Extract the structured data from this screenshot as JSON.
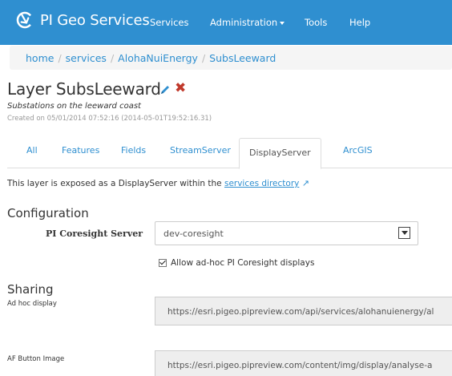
{
  "navbar": {
    "brand": "PI Geo Services",
    "items": [
      {
        "label": "Services"
      },
      {
        "label": "Administration"
      },
      {
        "label": "Tools"
      },
      {
        "label": "Help"
      }
    ]
  },
  "breadcrumb": [
    "home",
    "services",
    "AlohaNuiEnergy",
    "SubsLeeward"
  ],
  "layer": {
    "title": "Layer SubsLeeward",
    "subtitle": "Substations on the leeward coast",
    "created": "Created on 05/01/2014 07:52:16 (2014-05-01T19:52:16.31)"
  },
  "tabs": [
    {
      "label": "All"
    },
    {
      "label": "Features"
    },
    {
      "label": "Fields"
    },
    {
      "label": "StreamServer"
    },
    {
      "label": "DisplayServer",
      "active": true
    },
    {
      "label": "ArcGIS"
    }
  ],
  "exposed": {
    "text": "This layer is exposed as a DisplayServer within the ",
    "link": "services directory"
  },
  "configuration": {
    "heading": "Configuration",
    "server_label": "PI Coresight Server",
    "server_value": "dev-coresight",
    "allow_adhoc_label": "Allow ad-hoc PI Coresight displays",
    "allow_adhoc_checked": true
  },
  "sharing": {
    "heading": "Sharing",
    "adhoc_label": "Ad hoc display",
    "adhoc_url": "https://esri.pigeo.pipreview.com/api/services/alohanuienergy/al",
    "af_label": "AF Button Image",
    "af_url": "https://esri.pigeo.pipreview.com/content/img/display/analyse-a"
  },
  "icons": {
    "logo": "pi-logo-icon",
    "edit": "pencil-icon",
    "delete": "x-icon",
    "external": "external-link-icon",
    "dropdown": "chevron-down-icon"
  },
  "colors": {
    "navbar": "#2f8fd0",
    "link": "#2f8fd0",
    "delete": "#c0392b"
  }
}
